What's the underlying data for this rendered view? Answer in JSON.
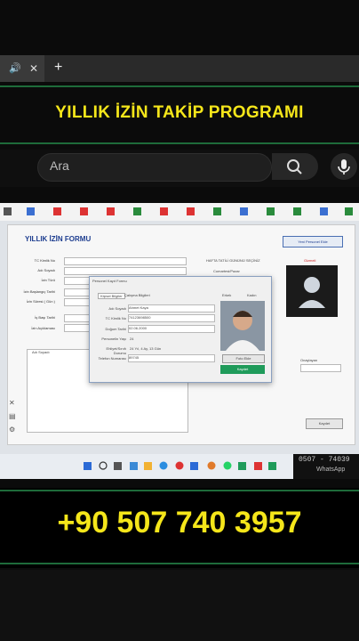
{
  "browser": {
    "tab_close": "✕",
    "new_tab": "+"
  },
  "banner": {
    "title": "YILLIK İZİN TAKİP PROGRAMI"
  },
  "search": {
    "placeholder": "Ara"
  },
  "form": {
    "title": "YILLIK İZİN FORMU",
    "labels": [
      "TC Kimlik No",
      "Adı Soyadı",
      "İzin Türü",
      "İzin Başlangıç Tarihi",
      "İzin Süresi ( Gün )",
      "İş Başı Tarihi",
      "İzin Açıklaması"
    ],
    "list_header": "Adı Soyadı",
    "new_personnel_btn": "Yeni Personel Ekle",
    "week_section": "HAFTA TATİLİ GÜNÜNÜ SEÇİNİZ",
    "week_option": "Cumartesi/Pazar",
    "hide_label": "Gizmeli",
    "other_label": "Onaylayan",
    "save_btn": "Kaydet"
  },
  "dialog": {
    "title": "Personel Kayıt Formu",
    "tabs": [
      "Kişisel Bilgiler",
      "Çalışma Bilgileri"
    ],
    "gender": [
      "Erkek",
      "Kadın"
    ],
    "fields": [
      {
        "label": "Adı Soyadı",
        "value": "Ahmet Kaya"
      },
      {
        "label": "TC Kimlik No",
        "value": "74123698500"
      },
      {
        "label": "Doğum Tarihi",
        "value": "02.06.2000"
      },
      {
        "label": "Personelin Yaşı",
        "value": "24"
      },
      {
        "label": "Ehliyet/Sınıfı Durumu",
        "value": "24 Yıl, 4 Ay, 13 Gün"
      },
      {
        "label": "Telefon Numarası",
        "value": "89745"
      }
    ],
    "photo_btn": "Foto Ekle",
    "save_btn": "Kaydet"
  },
  "taskbar": {
    "whatsapp_number": "0507 - 74039",
    "whatsapp_label": "WhatsApp"
  },
  "phone": {
    "number": "+90 507 740 3957"
  },
  "colors": {
    "accent_yellow": "#f5e61a",
    "form_title": "#1d3d8f",
    "border_green": "#1e6b3a"
  }
}
